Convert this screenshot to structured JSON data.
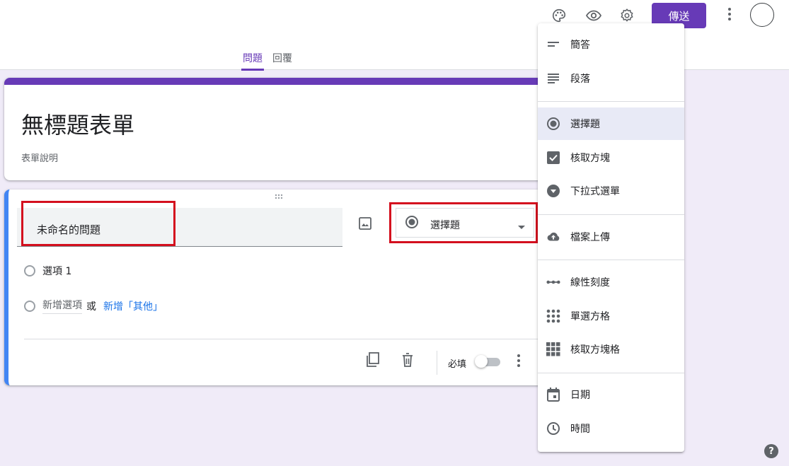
{
  "header": {
    "tabs": [
      {
        "label": "問題",
        "active": true
      },
      {
        "label": "回覆",
        "active": false
      }
    ],
    "send_label": "傳送",
    "icons": [
      "palette-icon",
      "eye-icon",
      "settings-icon",
      "more-vert-icon"
    ]
  },
  "form": {
    "title": "無標題表單",
    "description": "表單說明"
  },
  "question": {
    "title": "未命名的問題",
    "type_selected": "選擇題",
    "options": [
      "選項 1"
    ],
    "add_option": "新增選項",
    "or_text": "或",
    "add_other": "新增「其他」",
    "required_label": "必填",
    "required": false
  },
  "type_menu": {
    "items": [
      {
        "label": "簡答",
        "icon": "short-answer-icon"
      },
      {
        "label": "段落",
        "icon": "paragraph-icon"
      },
      {
        "label": "選擇題",
        "icon": "radio-icon",
        "selected": true
      },
      {
        "label": "核取方塊",
        "icon": "checkbox-icon"
      },
      {
        "label": "下拉式選單",
        "icon": "dropdown-icon"
      },
      {
        "label": "檔案上傳",
        "icon": "cloud-upload-icon"
      },
      {
        "label": "線性刻度",
        "icon": "linear-scale-icon"
      },
      {
        "label": "單選方格",
        "icon": "grid-dots-icon"
      },
      {
        "label": "核取方塊格",
        "icon": "grid-squares-icon"
      },
      {
        "label": "日期",
        "icon": "calendar-icon"
      },
      {
        "label": "時間",
        "icon": "clock-icon"
      }
    ]
  },
  "colors": {
    "accent": "#673ab7",
    "highlight": "#d40f1e",
    "question_border": "#4285f4"
  }
}
